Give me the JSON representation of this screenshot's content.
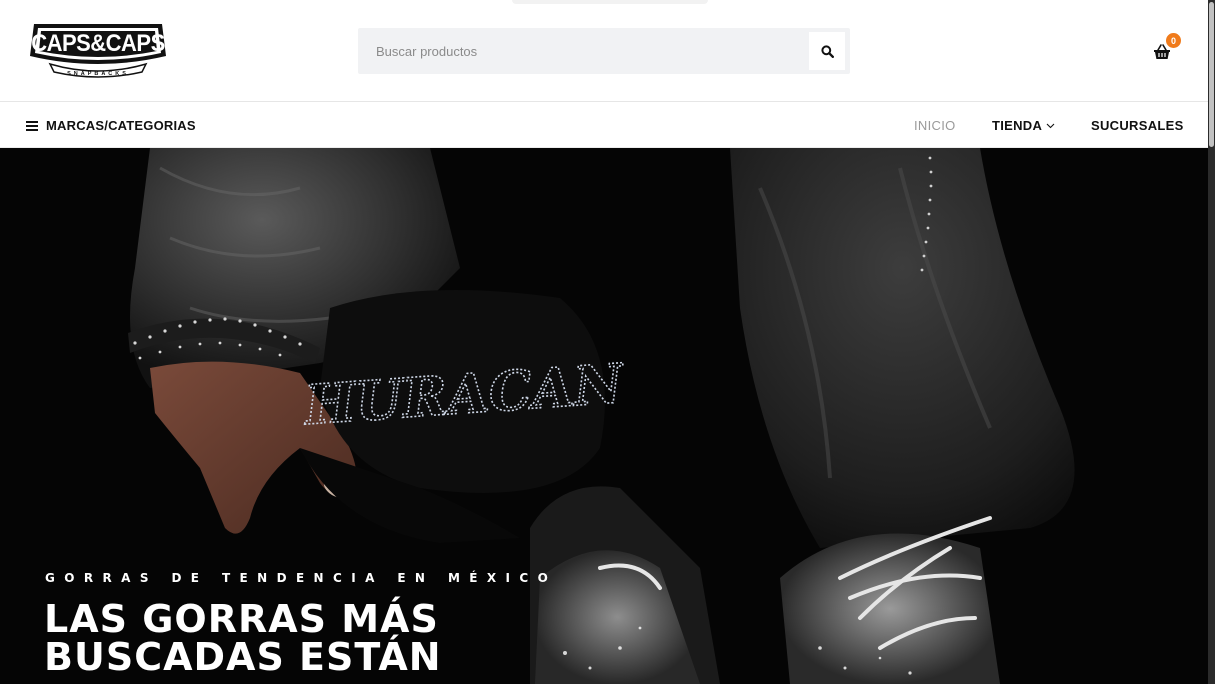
{
  "header": {
    "logo": {
      "text_top": "CAPS&CAPS",
      "text_sub": "SNAPBACKS"
    },
    "search": {
      "placeholder": "Buscar productos"
    },
    "cart": {
      "count": "0"
    }
  },
  "nav": {
    "menu_label": "MARCAS/CATEGORIAS",
    "items": [
      {
        "label": "INICIO"
      },
      {
        "label": "TIENDA"
      },
      {
        "label": "SUCURSALES"
      }
    ]
  },
  "hero": {
    "kicker": "GORRAS DE TENDENCIA EN MÉXICO",
    "title": "LAS GORRAS MÁS BUSCADAS ESTÁN",
    "cap_text": "HURACAN"
  },
  "colors": {
    "accent": "#f07b1b",
    "text": "#111111",
    "muted": "#9a9a9a",
    "search_bg": "#f1f2f4"
  },
  "icons": [
    "menu-icon",
    "search-icon",
    "cart-basket-icon",
    "chevron-down-icon"
  ]
}
